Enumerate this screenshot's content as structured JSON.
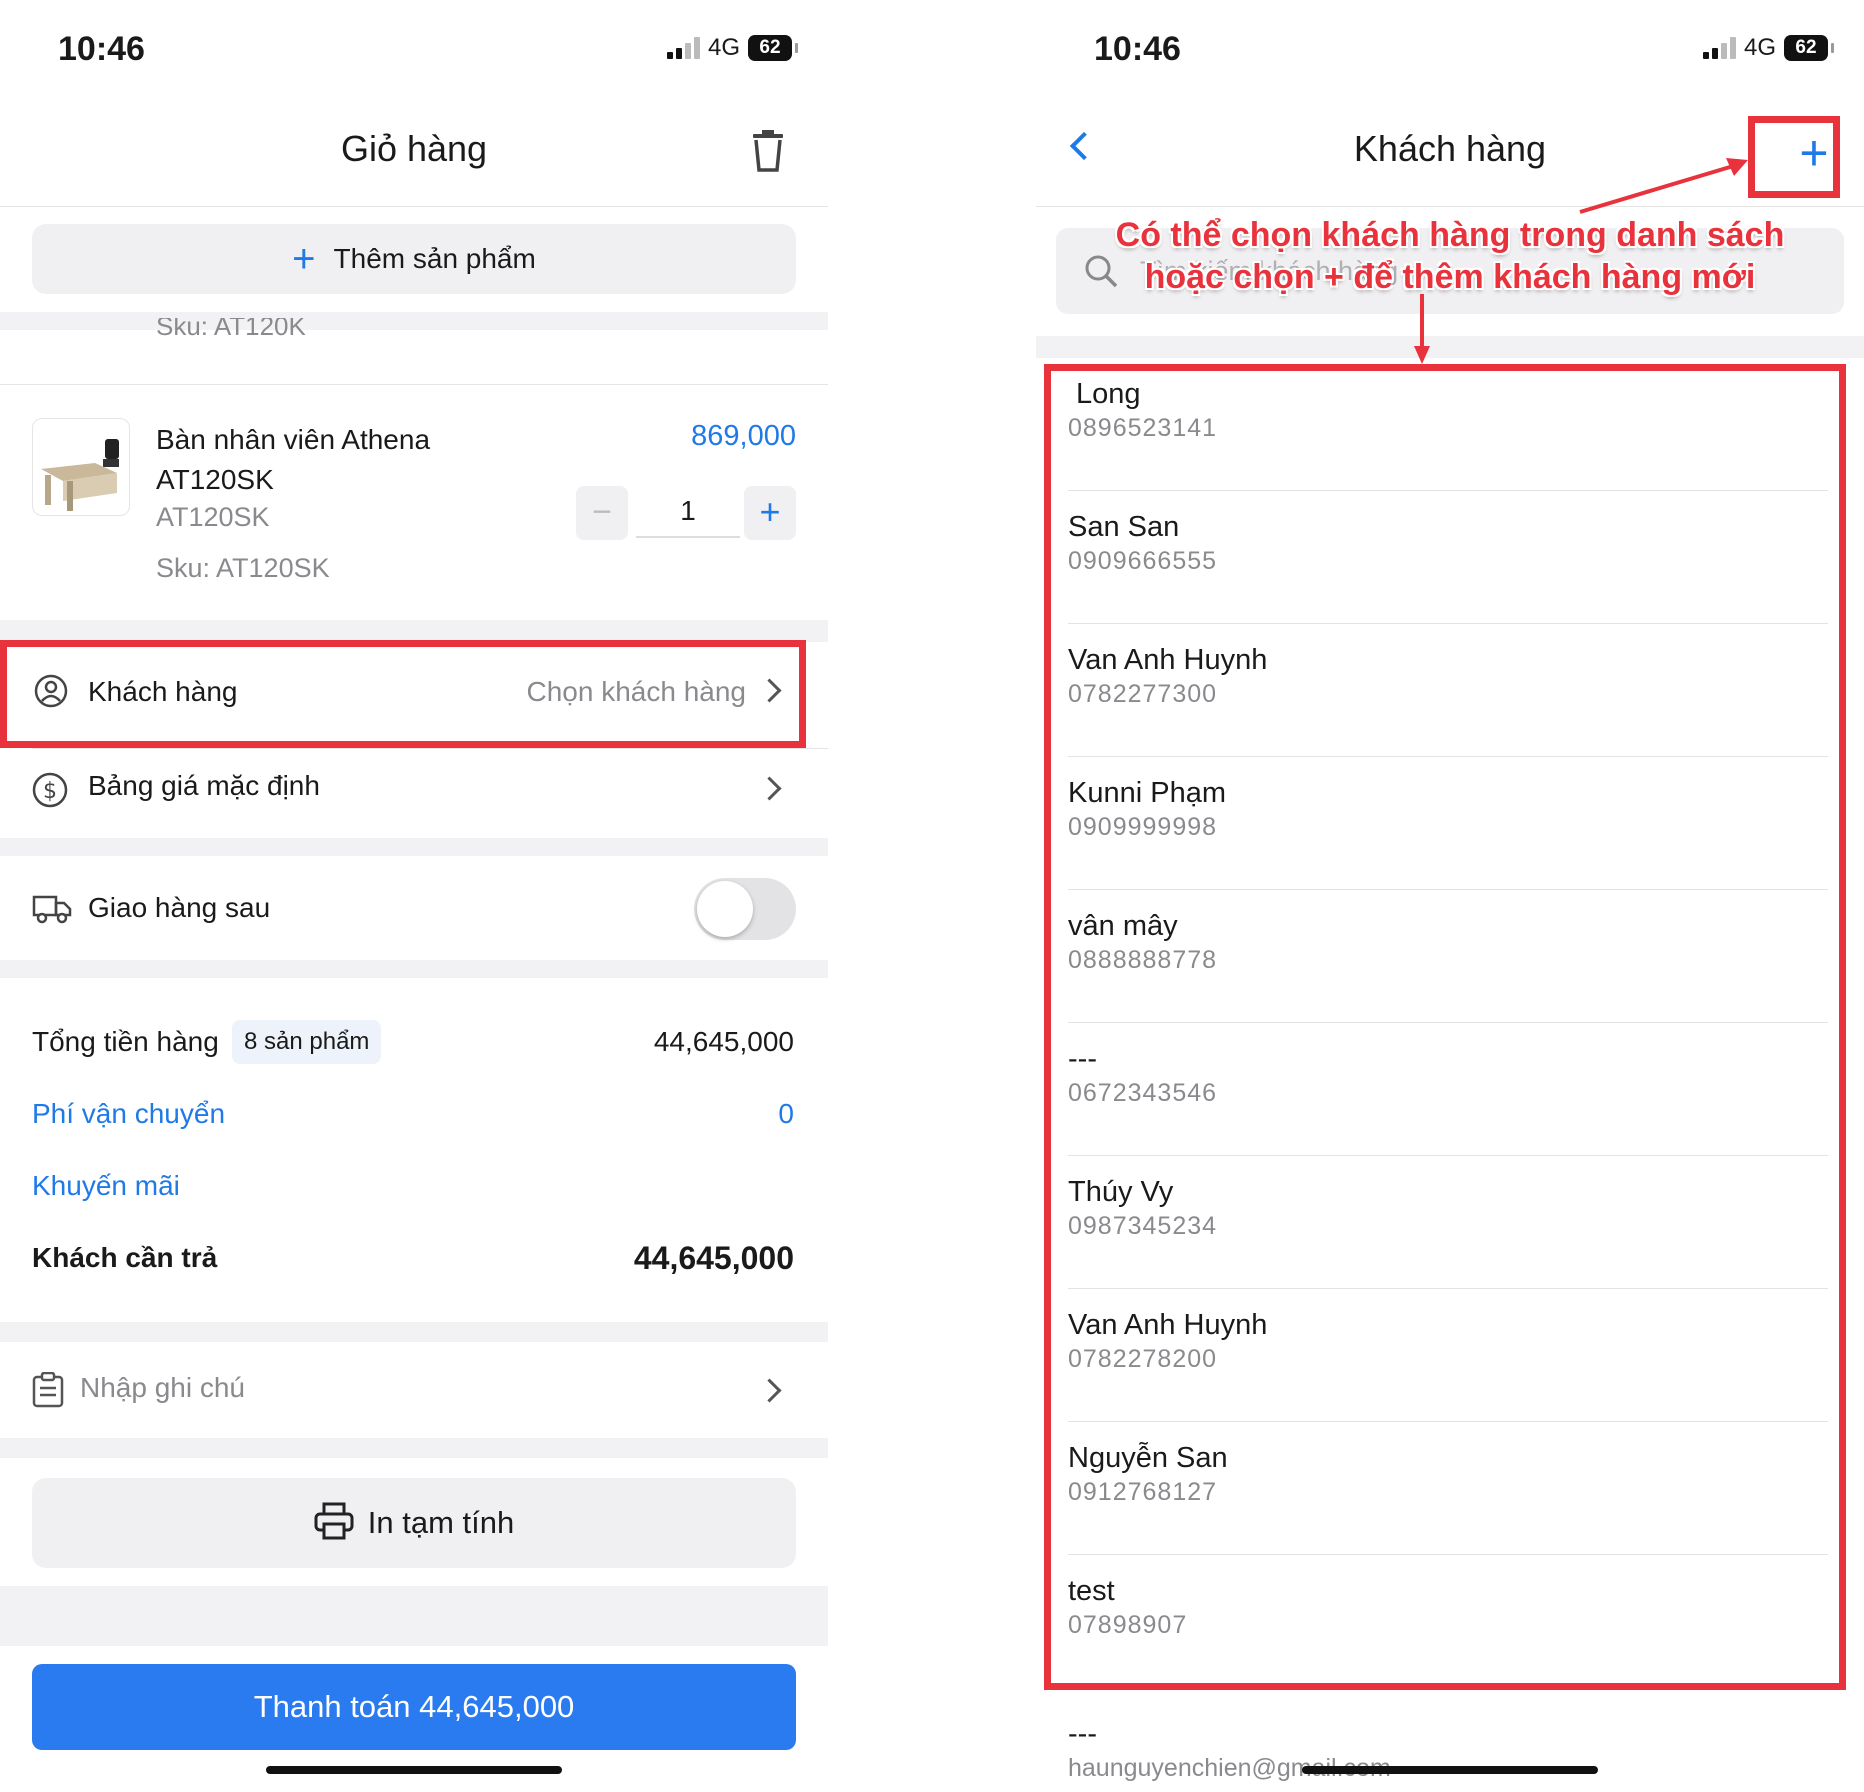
{
  "left": {
    "status": {
      "time": "10:46",
      "network": "4G",
      "battery": "62"
    },
    "nav": {
      "title": "Giỏ hàng",
      "trash_icon": "trash-icon"
    },
    "add_product": {
      "icon": "plus-icon",
      "label": "Thêm sản phẩm"
    },
    "prev_sku": "Sku: AT120K",
    "product": {
      "name_line1": "Bàn nhân viên Athena",
      "name_line2": "AT120SK",
      "variant": "AT120SK",
      "sku": "Sku: AT120SK",
      "price": "869,000",
      "qty": "1",
      "minus": "−",
      "plus": "+"
    },
    "customer_row": {
      "label": "Khách hàng",
      "value": "Chọn khách hàng"
    },
    "pricelist_row": {
      "label": "Bảng giá mặc định"
    },
    "delivery_row": {
      "label": "Giao hàng sau",
      "toggle_on": false
    },
    "summary": {
      "total_label": "Tổng tiền hàng",
      "total_badge": "8 sản phẩm",
      "total_value": "44,645,000",
      "shipping_label": "Phí vận chuyển",
      "shipping_value": "0",
      "promo_label": "Khuyến mãi",
      "pay_label": "Khách cần trả",
      "pay_value": "44,645,000"
    },
    "note_placeholder": "Nhập ghi chú",
    "print_label": "In tạm tính",
    "checkout_label": "Thanh toán 44,645,000"
  },
  "right": {
    "status": {
      "time": "10:46",
      "network": "4G",
      "battery": "62"
    },
    "nav": {
      "title": "Khách hàng",
      "back_icon": "back-chevron-icon",
      "add": "+"
    },
    "search_placeholder": "Tìm kiếm khách hàng",
    "annotation": {
      "line1": "Có thể chọn khách hàng trong danh sách",
      "line2": "hoặc chọn + để thêm khách hàng mới",
      "color": "#e8323c"
    },
    "customers": [
      {
        "name": "Long",
        "phone": "0896523141"
      },
      {
        "name": "San San",
        "phone": "0909666555"
      },
      {
        "name": "Van Anh Huynh",
        "phone": "0782277300"
      },
      {
        "name": "Kunni Phạm",
        "phone": "0909999998"
      },
      {
        "name": "vân mây",
        "phone": "0888888778"
      },
      {
        "name": "---",
        "phone": "0672343546"
      },
      {
        "name": "Thúy Vy",
        "phone": "0987345234"
      },
      {
        "name": "Van Anh Huynh",
        "phone": "0782278200"
      },
      {
        "name": "Nguyễn San",
        "phone": "0912768127"
      },
      {
        "name": "test",
        "phone": "07898907"
      }
    ],
    "extra_customer": {
      "name": "---",
      "phone": "haunguyenchien@gmail.com"
    }
  },
  "colors": {
    "accent": "#1f7ae8",
    "annotation": "#e8323c",
    "checkout_bg": "#2a7bf0"
  }
}
